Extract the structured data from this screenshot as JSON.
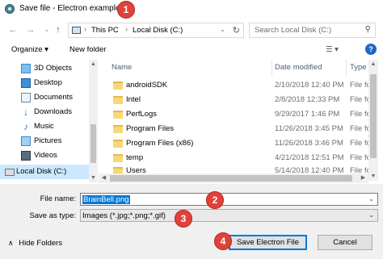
{
  "window": {
    "title": "Save file - Electron example"
  },
  "annotations": [
    "1",
    "2",
    "3",
    "4"
  ],
  "nav": {
    "back_icon": "arrow-left-icon",
    "forward_icon": "arrow-right-icon",
    "recent_icon": "chevron-down-icon",
    "up_icon": "arrow-up-icon",
    "breadcrumb": [
      "This PC",
      "Local Disk (C:)"
    ],
    "search_placeholder": "Search Local Disk (C:)"
  },
  "toolbar": {
    "organize_label": "Organize ▾",
    "new_folder_label": "New folder",
    "view_icon": "view-options-icon",
    "help_label": "?"
  },
  "sidebar": {
    "items": [
      {
        "label": "3D Objects",
        "icon": "cube-icon",
        "selected": false
      },
      {
        "label": "Desktop",
        "icon": "desktop-icon",
        "selected": false
      },
      {
        "label": "Documents",
        "icon": "documents-icon",
        "selected": false
      },
      {
        "label": "Downloads",
        "icon": "download-icon",
        "selected": false
      },
      {
        "label": "Music",
        "icon": "music-icon",
        "selected": false
      },
      {
        "label": "Pictures",
        "icon": "pictures-icon",
        "selected": false
      },
      {
        "label": "Videos",
        "icon": "video-icon",
        "selected": false
      },
      {
        "label": "Local Disk (C:)",
        "icon": "drive-icon",
        "selected": true
      }
    ]
  },
  "files": {
    "columns": [
      "Name",
      "Date modified",
      "Type"
    ],
    "rows": [
      {
        "name": "androidSDK",
        "date": "2/10/2018 12:40 PM",
        "type": "File fol"
      },
      {
        "name": "Intel",
        "date": "2/8/2018 12:33 PM",
        "type": "File fol"
      },
      {
        "name": "PerfLogs",
        "date": "9/29/2017 1:46 PM",
        "type": "File fol"
      },
      {
        "name": "Program Files",
        "date": "11/26/2018 3:45 PM",
        "type": "File fol"
      },
      {
        "name": "Program Files (x86)",
        "date": "11/26/2018 3:46 PM",
        "type": "File fol"
      },
      {
        "name": "temp",
        "date": "4/21/2018 12:51 PM",
        "type": "File fol"
      },
      {
        "name": "Users",
        "date": "5/14/2018 12:40 PM",
        "type": "File fol"
      }
    ]
  },
  "form": {
    "file_name_label": "File name:",
    "file_name_value": "BrainBell.png",
    "save_type_label": "Save as type:",
    "save_type_value": "Images (*.jpg;*.png;*.gif)"
  },
  "footer": {
    "hide_folders_label": "Hide Folders",
    "save_label": "Save Electron File",
    "cancel_label": "Cancel"
  },
  "colors": {
    "badge": "#e0413a",
    "selection": "#cce8ff",
    "accent": "#0078d7",
    "folder": "#f8d775"
  }
}
